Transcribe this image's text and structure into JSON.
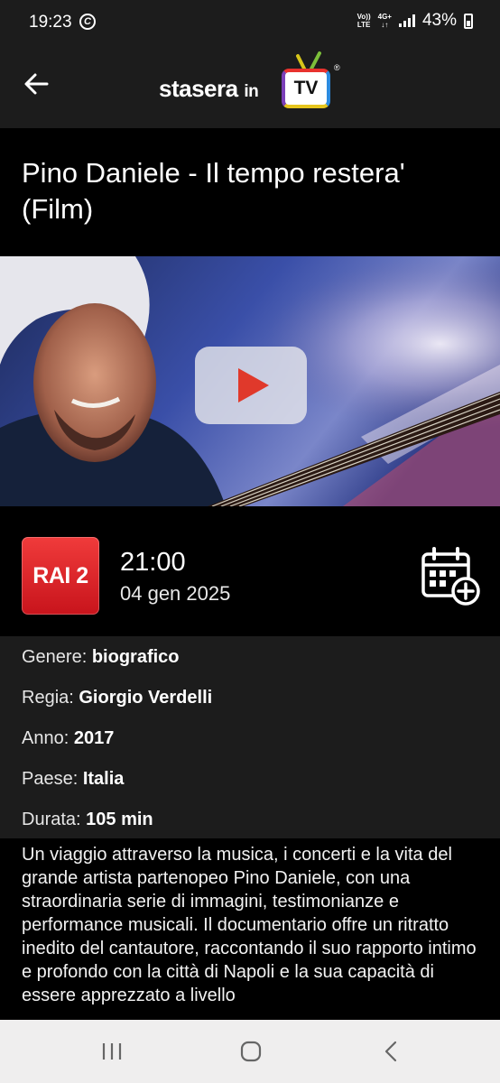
{
  "status_bar": {
    "time": "19:23",
    "c_icon": "C",
    "volte_top": "Vo))",
    "volte_bottom": "LTE",
    "network_top": "4G+",
    "network_bottom": "↓↑",
    "battery": "43%"
  },
  "header": {
    "back_icon": "arrow-left-icon",
    "logo_main": "stasera",
    "logo_in": "in",
    "logo_tv": "TV",
    "logo_reg": "®"
  },
  "program": {
    "title": "Pino Daniele - Il tempo restera' (Film)",
    "channel": "RAI 2",
    "time": "21:00",
    "date": "04 gen 2025"
  },
  "details": {
    "genre_label": "Genere:",
    "genre": "biografico",
    "director_label": "Regia:",
    "director": "Giorgio Verdelli",
    "year_label": "Anno:",
    "year": "2017",
    "country_label": "Paese:",
    "country": "Italia",
    "duration_label": "Durata:",
    "duration": "105 min"
  },
  "description": "Un viaggio attraverso la musica, i concerti e la vita del grande artista partenopeo Pino Daniele, con una straordinaria serie di immagini, testimonianze e performance musicali. Il documentario offre un ritratto inedito del cantautore, raccontando il suo rapporto intimo e profondo con la città di Napoli e la sua capacità di essere apprezzato a livello",
  "colors": {
    "header_bg": "#1c1c1c",
    "page_bg": "#000000",
    "channel_red": "#e02a2a",
    "play_red": "#e0392b",
    "nav_bg": "#efeeee"
  }
}
